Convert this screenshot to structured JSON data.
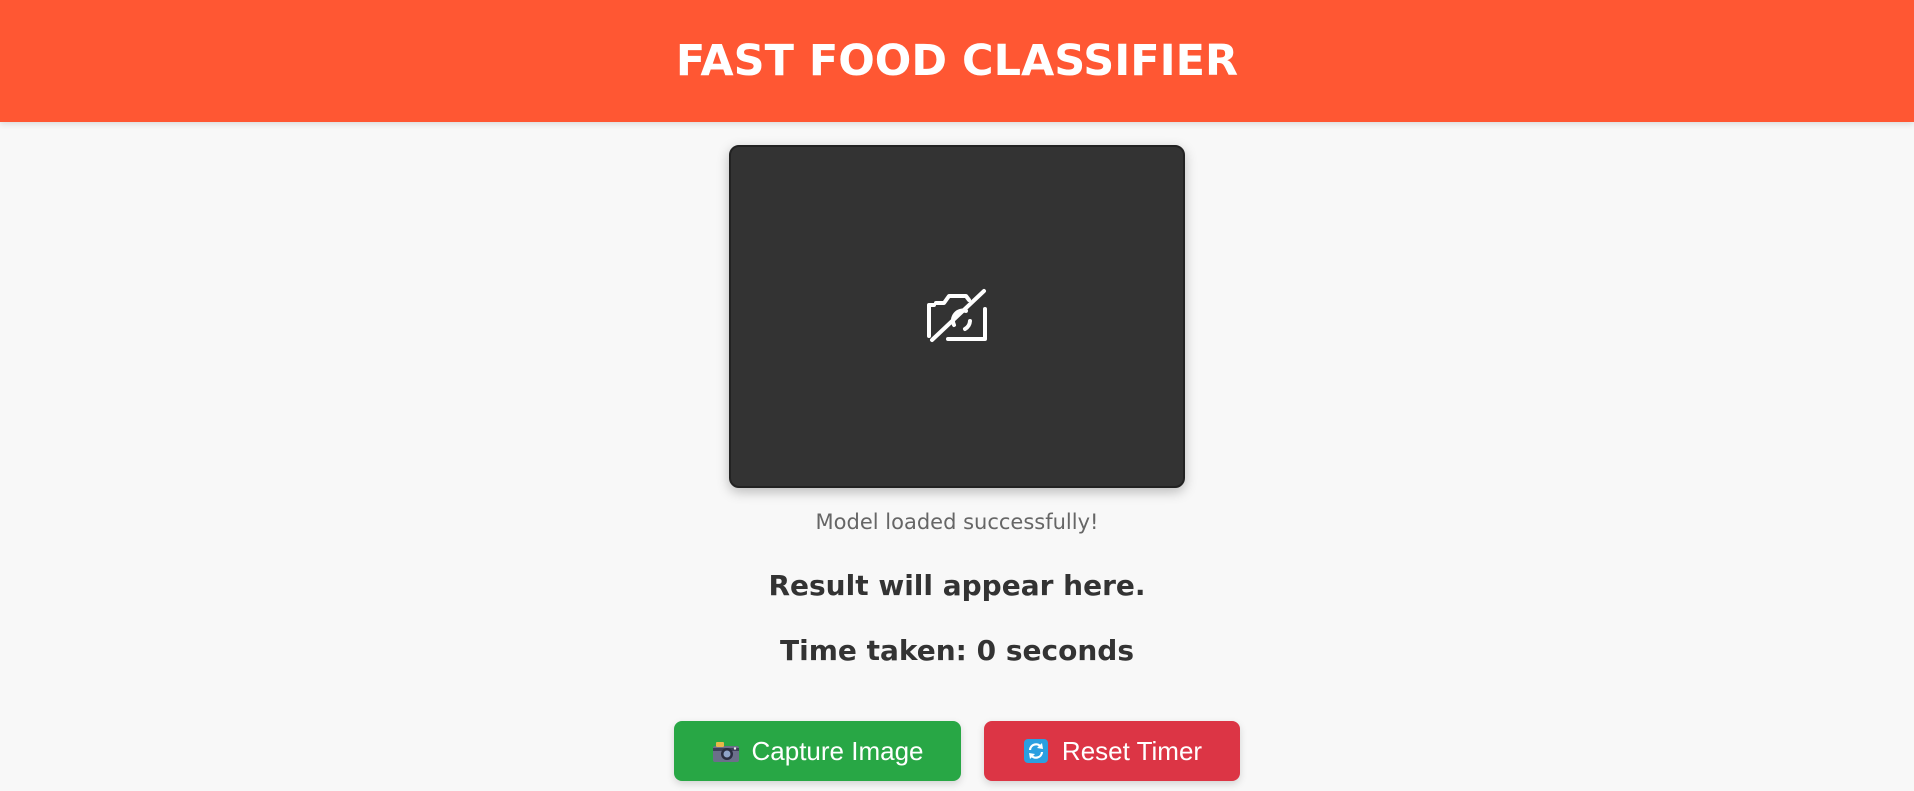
{
  "header": {
    "title": "FAST FOOD CLASSIFIER",
    "color": "#ff5733"
  },
  "camera": {
    "icon": "camera-off-icon"
  },
  "status": {
    "text": "Model loaded successfully!"
  },
  "result": {
    "text": "Result will appear here."
  },
  "timer": {
    "text": "Time taken: 0 seconds"
  },
  "buttons": {
    "capture": {
      "label": "Capture Image",
      "icon": "camera-icon",
      "color": "#28a745"
    },
    "reset": {
      "label": "Reset Timer",
      "icon": "refresh-icon",
      "color": "#dc3545"
    }
  }
}
